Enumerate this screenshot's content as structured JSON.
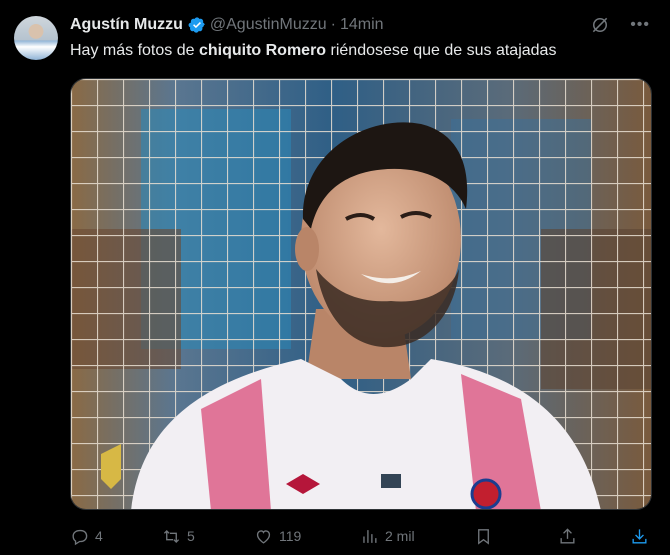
{
  "tweet": {
    "author_name": "Agustín Muzzu",
    "handle": "@AgustinMuzzu",
    "separator": "·",
    "time": "14min",
    "text_before": "Hay más fotos de ",
    "text_bold": "chiquito Romero",
    "text_after": " riéndosese que de sus atajadas"
  },
  "actions": {
    "replies": "4",
    "reposts": "5",
    "likes": "119",
    "views": "2 mil"
  },
  "colors": {
    "background": "#000000",
    "text": "#e7e9ea",
    "muted": "#71767b",
    "verified": "#1d9bf0",
    "download": "#1d9bf0"
  },
  "icons": [
    "verified-badge-icon",
    "grok-icon",
    "more-icon",
    "reply-icon",
    "repost-icon",
    "like-icon",
    "views-icon",
    "bookmark-icon",
    "share-icon",
    "download-icon"
  ]
}
